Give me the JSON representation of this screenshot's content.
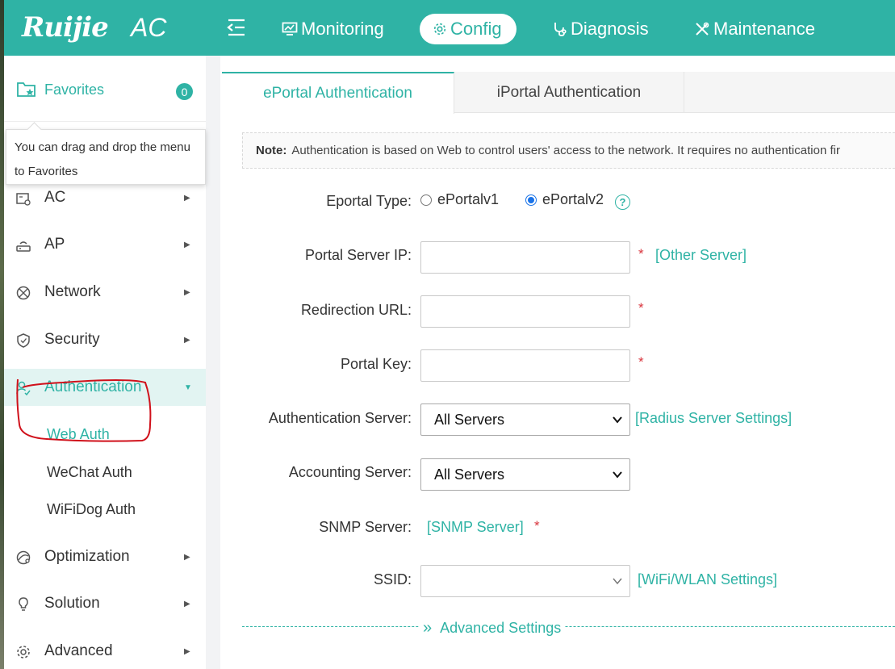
{
  "header": {
    "logo": "Ruijie",
    "product": "AC",
    "nav": [
      {
        "label": "Monitoring",
        "icon": "monitor-icon"
      },
      {
        "label": "Config",
        "icon": "gear-icon",
        "active": true
      },
      {
        "label": "Diagnosis",
        "icon": "stethoscope-icon"
      },
      {
        "label": "Maintenance",
        "icon": "tools-icon"
      }
    ]
  },
  "sidebar": {
    "favorites": {
      "label": "Favorites",
      "count": "0"
    },
    "tooltip": "You can drag and drop the menu to Favorites",
    "items": [
      {
        "label": "AC",
        "icon": "ac-icon"
      },
      {
        "label": "AP",
        "icon": "ap-icon"
      },
      {
        "label": "Network",
        "icon": "network-icon"
      },
      {
        "label": "Security",
        "icon": "shield-icon"
      },
      {
        "label": "Authentication",
        "icon": "user-check-icon",
        "active": true
      },
      {
        "label": "Optimization",
        "icon": "optimization-icon"
      },
      {
        "label": "Solution",
        "icon": "bulb-icon"
      },
      {
        "label": "Advanced",
        "icon": "gear-icon"
      }
    ],
    "sub_items": [
      {
        "label": "Web Auth",
        "active": true
      },
      {
        "label": "WeChat Auth"
      },
      {
        "label": "WiFiDog Auth"
      }
    ]
  },
  "tabs": [
    {
      "label": "ePortal Authentication",
      "active": true
    },
    {
      "label": "iPortal Authentication"
    }
  ],
  "note": {
    "prefix": "Note:",
    "text": "Authentication is based on Web to control users' access to the network. It requires no authentication fir"
  },
  "form": {
    "eportal_type": {
      "label": "Eportal Type:",
      "options": [
        "ePortalv1",
        "ePortalv2"
      ],
      "selected": "ePortalv2"
    },
    "portal_server_ip": {
      "label": "Portal Server IP:",
      "value": "",
      "link": "[Other Server]"
    },
    "redirection_url": {
      "label": "Redirection URL:",
      "value": ""
    },
    "portal_key": {
      "label": "Portal Key:",
      "value": ""
    },
    "authentication_server": {
      "label": "Authentication Server:",
      "value": "All Servers",
      "link": "[Radius Server Settings]"
    },
    "accounting_server": {
      "label": "Accounting Server:",
      "value": "All Servers"
    },
    "snmp_server": {
      "label": "SNMP Server:",
      "link": "[SNMP Server]"
    },
    "ssid": {
      "label": "SSID:",
      "value": "",
      "link": "[WiFi/WLAN Settings]"
    },
    "required_mark": "*"
  },
  "advanced": {
    "label": "Advanced Settings"
  },
  "colors": {
    "accent": "#2fb3a5",
    "required": "#d9363e",
    "annotation": "#d0111b"
  }
}
